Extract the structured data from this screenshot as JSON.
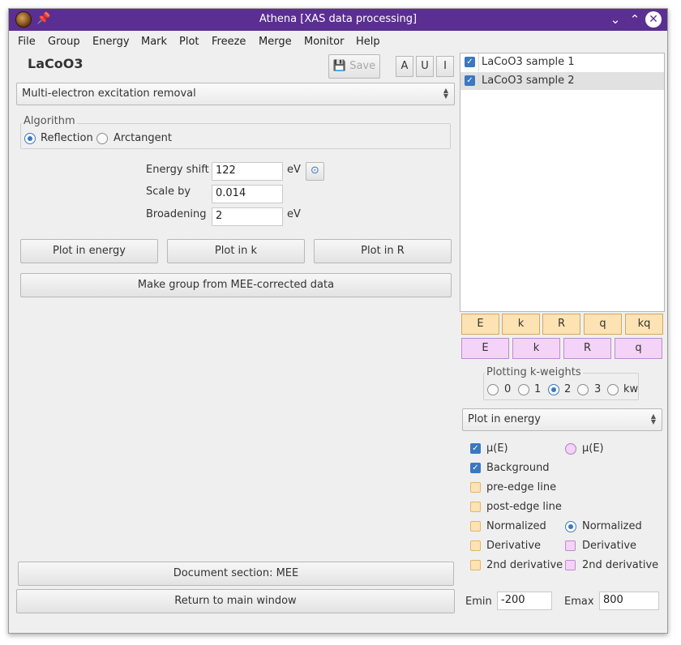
{
  "titlebar": {
    "title": "Athena [XAS data processing]"
  },
  "menu": [
    "File",
    "Group",
    "Energy",
    "Mark",
    "Plot",
    "Freeze",
    "Merge",
    "Monitor",
    "Help"
  ],
  "group_title": "LaCoO3",
  "toolbar": {
    "save_label": "Save",
    "a": "A",
    "u": "U",
    "i": "I"
  },
  "tool_select": "Multi-electron excitation removal",
  "algorithm": {
    "legend": "Algorithm",
    "options": [
      "Reflection",
      "Arctangent"
    ],
    "selected": "Reflection"
  },
  "params": {
    "energy_shift_label": "Energy shift",
    "energy_shift_value": "122",
    "energy_shift_unit": "eV",
    "scale_label": "Scale by",
    "scale_value": "0.014",
    "broadening_label": "Broadening",
    "broadening_value": "2",
    "broadening_unit": "eV"
  },
  "plot_buttons": [
    "Plot in energy",
    "Plot in k",
    "Plot in R"
  ],
  "make_group_label": "Make group from MEE-corrected data",
  "document_label": "Document section: MEE",
  "return_label": "Return to main window",
  "groups": [
    {
      "name": "LaCoO3 sample 1",
      "checked": true
    },
    {
      "name": "LaCoO3 sample 2",
      "checked": true,
      "selected": true
    }
  ],
  "plot_row_1": [
    "E",
    "k",
    "R",
    "q",
    "kq"
  ],
  "plot_row_2": [
    "E",
    "k",
    "R",
    "q"
  ],
  "kweights": {
    "legend": "Plotting k-weights",
    "options": [
      "0",
      "1",
      "2",
      "3",
      "kw"
    ],
    "selected": "2"
  },
  "plot_mode": "Plot in energy",
  "energy_options": {
    "left": [
      {
        "label": "μ(E)",
        "checked": true
      },
      {
        "label": "Background",
        "checked": true
      },
      {
        "label": "pre-edge line",
        "checked": false
      },
      {
        "label": "post-edge line",
        "checked": false
      },
      {
        "label": "Normalized",
        "checked": false
      },
      {
        "label": "Derivative",
        "checked": false
      },
      {
        "label": "2nd derivative",
        "checked": false
      }
    ],
    "right": [
      {
        "label": "μ(E)",
        "kind": "radio",
        "on": false
      },
      {
        "label": "Normalized",
        "kind": "radio",
        "on": true
      },
      {
        "label": "Derivative",
        "kind": "check",
        "on": false
      },
      {
        "label": "2nd derivative",
        "kind": "check",
        "on": false
      }
    ]
  },
  "range": {
    "emin_label": "Emin",
    "emin_value": "-200",
    "emax_label": "Emax",
    "emax_value": "800"
  },
  "colors": {
    "titlebar": "#5b2e91",
    "accent": "#3a78c2",
    "orange": "#fde3b3",
    "pink": "#f3d3f7"
  }
}
